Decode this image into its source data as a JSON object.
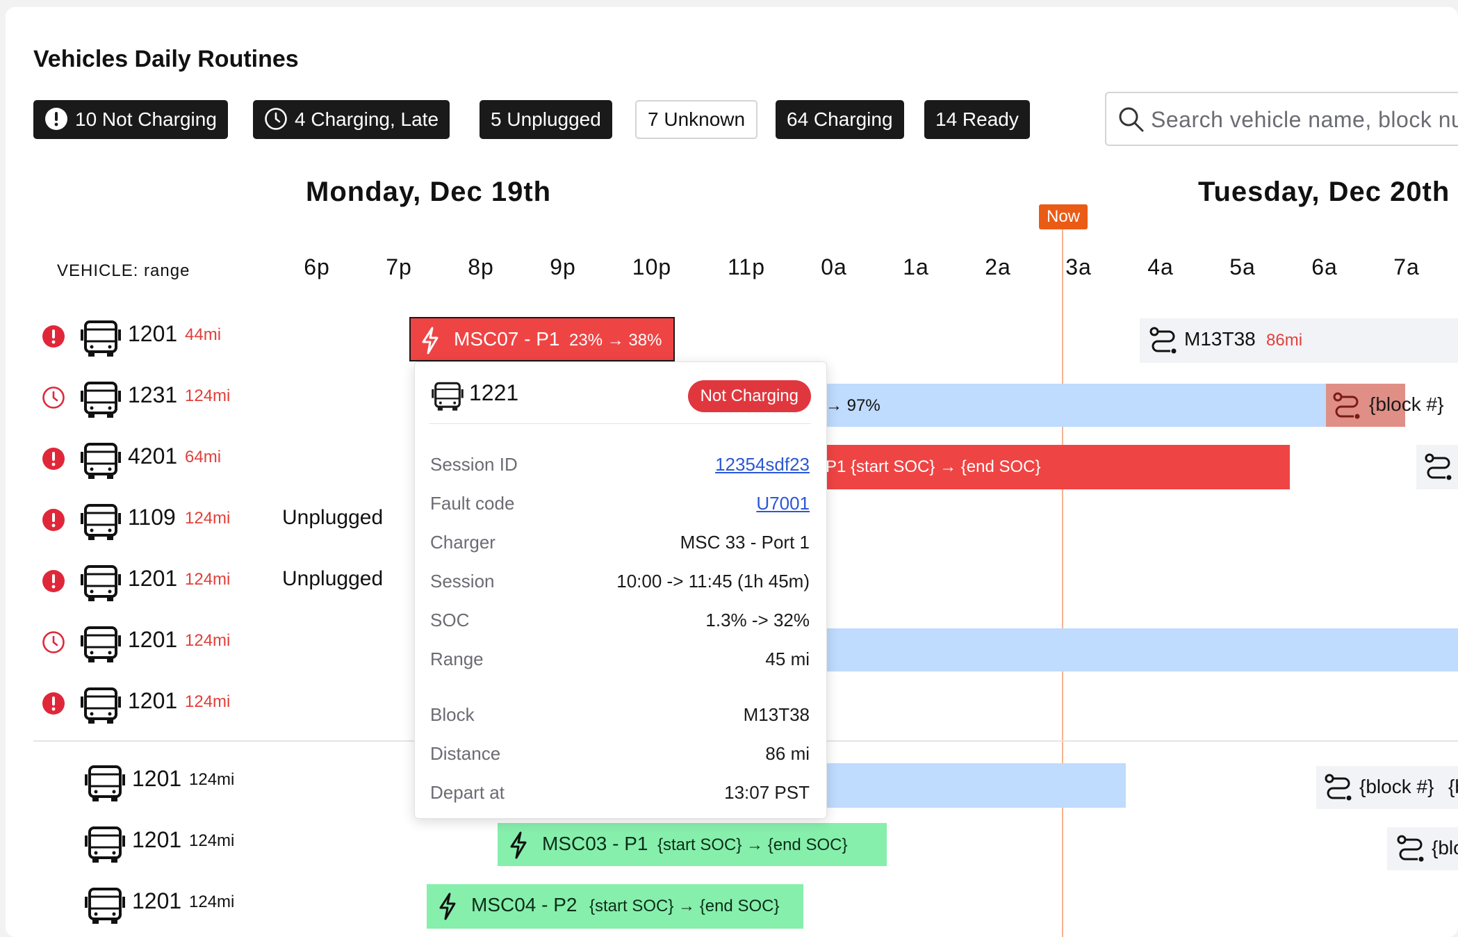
{
  "title": "Vehicles Daily Routines",
  "filters": [
    {
      "label": "10 Not Charging",
      "icon": "alert-circle-icon"
    },
    {
      "label": "4 Charging, Late",
      "icon": "clock-icon"
    },
    {
      "label": "5 Unplugged"
    },
    {
      "label": "7 Unknown"
    },
    {
      "label": "64 Charging"
    },
    {
      "label": "14 Ready"
    }
  ],
  "search": {
    "placeholder": "Search vehicle name, block number"
  },
  "days": {
    "monday": "Monday, Dec 19th",
    "tuesday": "Tuesday, Dec 20th"
  },
  "vehicle_header": "VEHICLE: range",
  "now_label": "Now",
  "hours": [
    "6p",
    "7p",
    "8p",
    "9p",
    "10p",
    "11p",
    "0a",
    "1a",
    "2a",
    "3a",
    "4a",
    "5a",
    "6a",
    "7a"
  ],
  "rows": [
    {
      "id": "1201",
      "range": "44mi",
      "status": "alert",
      "bars": [
        {
          "type": "red-outlined",
          "label": "MSC07 - P1",
          "soc": "23% → 38%"
        },
        {
          "type": "route",
          "label": "M13T38",
          "dist": "86mi"
        }
      ]
    },
    {
      "id": "1231",
      "range": "124mi",
      "status": "clock",
      "bars": [
        {
          "type": "blue",
          "soc": "→ 97%"
        },
        {
          "type": "route-red",
          "label": "{block #}"
        }
      ]
    },
    {
      "id": "4201",
      "range": "64mi",
      "status": "alert",
      "bars": [
        {
          "type": "red",
          "label": "P1 {start SOC} → {end SOC}"
        }
      ]
    },
    {
      "id": "1109",
      "range": "124mi",
      "status": "alert",
      "note": "Unplugged"
    },
    {
      "id": "1201",
      "range": "124mi",
      "status": "alert",
      "note": "Unplugged"
    },
    {
      "id": "1201",
      "range": "124mi",
      "status": "clock"
    },
    {
      "id": "1201",
      "range": "124mi",
      "status": "alert"
    },
    {
      "id": "1201",
      "range": "124mi",
      "bars": [
        {
          "type": "route",
          "label": "{block #}",
          "extra": "{b"
        }
      ]
    },
    {
      "id": "1201",
      "range": "124mi",
      "bars": [
        {
          "type": "green",
          "label": "MSC03 - P1",
          "soc": "{start SOC} → {end SOC}"
        },
        {
          "type": "route",
          "label": "{blo"
        }
      ]
    },
    {
      "id": "1201",
      "range": "124mi",
      "bars": [
        {
          "type": "green",
          "label": "MSC04 - P2",
          "soc": "{start SOC} → {end SOC}"
        }
      ]
    }
  ],
  "tooltip": {
    "vehicle": "1221",
    "status": "Not Charging",
    "fields": [
      {
        "key": "Session ID",
        "value": "12354sdf23",
        "link": true
      },
      {
        "key": "Fault code",
        "value": "U7001",
        "link": true
      },
      {
        "key": "Charger",
        "value": "MSC 33 - Port 1"
      },
      {
        "key": "Session",
        "value": "10:00 -> 11:45 (1h 45m)"
      },
      {
        "key": "SOC",
        "value": "1.3% -> 32%"
      },
      {
        "key": "Range",
        "value": "45 mi"
      },
      {
        "key": "Block",
        "value": "M13T38"
      },
      {
        "key": "Distance",
        "value": "86 mi"
      },
      {
        "key": "Depart at",
        "value": "13:07 PST"
      }
    ]
  },
  "colors": {
    "alert": "#e0273a",
    "red_bar": "#ef4444",
    "blue_bar": "#bfdbfe",
    "green_bar": "#86efac",
    "now": "#ea5b16",
    "link": "#2b57d6"
  }
}
